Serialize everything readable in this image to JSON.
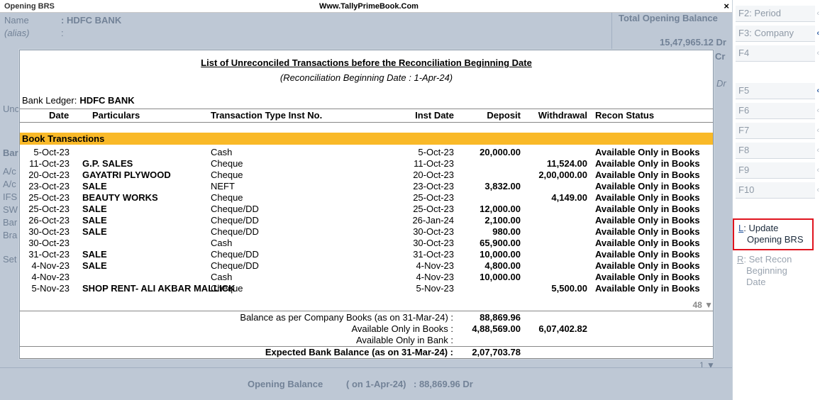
{
  "window": {
    "title": "Opening BRS",
    "site": "Www.TallyPrimeBook.Com",
    "close": "×"
  },
  "background": {
    "name_label": "Name",
    "name_value": ": HDFC BANK",
    "alias_label": "(alias)",
    "alias_colon": ":",
    "total_label": "Total Opening Balance",
    "total_value": "15,47,965.12 Dr",
    "cr_fragment": "Cr",
    "dr_fragment": "Dr",
    "unc_fragment": "Unc",
    "bank_fragment": "Bar",
    "ac1_fragment": "A/c",
    "ac2_fragment": "A/c",
    "ifs_fragment": "IFS",
    "sw_fragment": "SW",
    "ban_fragment": "Bar",
    "bra_fragment": "Bra",
    "set_fragment": "Set",
    "opening_label": "Opening Balance",
    "opening_on": "( on 1-Apr-24)",
    "opening_value": ":  88,869.96 Dr",
    "page_indicator": "1 ▼"
  },
  "modal": {
    "title": "List of Unreconciled Transactions before the Reconciliation Beginning Date",
    "subtitle": "(Reconciliation Beginning Date :  1-Apr-24)",
    "bank_ledger_label": "Bank Ledger:",
    "bank_ledger_value": "HDFC BANK",
    "columns": {
      "date": "Date",
      "particulars": "Particulars",
      "type_inst": "Transaction Type  Inst No.",
      "inst_date": "Inst Date",
      "deposit": "Deposit",
      "withdrawal": "Withdrawal",
      "status": "Recon Status"
    },
    "section": "Book Transactions",
    "rows": [
      {
        "date": "5-Oct-23",
        "particulars": "",
        "type": "Cash",
        "inst_date": "5-Oct-23",
        "deposit": "20,000.00",
        "withdrawal": "",
        "status": "Available Only in Books"
      },
      {
        "date": "11-Oct-23",
        "particulars": "G.P. SALES",
        "type": "Cheque",
        "inst_date": "11-Oct-23",
        "deposit": "",
        "withdrawal": "11,524.00",
        "status": "Available Only in Books"
      },
      {
        "date": "20-Oct-23",
        "particulars": "GAYATRI PLYWOOD",
        "type": "Cheque",
        "inst_date": "20-Oct-23",
        "deposit": "",
        "withdrawal": "2,00,000.00",
        "status": "Available Only in Books"
      },
      {
        "date": "23-Oct-23",
        "particulars": "SALE",
        "type": "NEFT",
        "inst_date": "23-Oct-23",
        "deposit": "3,832.00",
        "withdrawal": "",
        "status": "Available Only in Books"
      },
      {
        "date": "25-Oct-23",
        "particulars": "BEAUTY WORKS",
        "type": "Cheque",
        "inst_date": "25-Oct-23",
        "deposit": "",
        "withdrawal": "4,149.00",
        "status": "Available Only in Books"
      },
      {
        "date": "25-Oct-23",
        "particulars": "SALE",
        "type": "Cheque/DD",
        "inst_date": "25-Oct-23",
        "deposit": "12,000.00",
        "withdrawal": "",
        "status": "Available Only in Books"
      },
      {
        "date": "26-Oct-23",
        "particulars": "SALE",
        "type": "Cheque/DD",
        "inst_date": "26-Jan-24",
        "deposit": "2,100.00",
        "withdrawal": "",
        "status": "Available Only in Books"
      },
      {
        "date": "30-Oct-23",
        "particulars": "SALE",
        "type": "Cheque/DD",
        "inst_date": "30-Oct-23",
        "deposit": "980.00",
        "withdrawal": "",
        "status": "Available Only in Books"
      },
      {
        "date": "30-Oct-23",
        "particulars": "",
        "type": "Cash",
        "inst_date": "30-Oct-23",
        "deposit": "65,900.00",
        "withdrawal": "",
        "status": "Available Only in Books"
      },
      {
        "date": "31-Oct-23",
        "particulars": "SALE",
        "type": "Cheque/DD",
        "inst_date": "31-Oct-23",
        "deposit": "10,000.00",
        "withdrawal": "",
        "status": "Available Only in Books"
      },
      {
        "date": "4-Nov-23",
        "particulars": "SALE",
        "type": "Cheque/DD",
        "inst_date": "4-Nov-23",
        "deposit": "4,800.00",
        "withdrawal": "",
        "status": "Available Only in Books"
      },
      {
        "date": "4-Nov-23",
        "particulars": "",
        "type": "Cash",
        "inst_date": "4-Nov-23",
        "deposit": "10,000.00",
        "withdrawal": "",
        "status": "Available Only in Books"
      },
      {
        "date": "5-Nov-23",
        "particulars": "SHOP RENT- ALI AKBAR MALLICK",
        "type": "Cheque",
        "inst_date": "5-Nov-23",
        "deposit": "",
        "withdrawal": "5,500.00",
        "status": "Available Only in Books"
      }
    ],
    "more_indicator": "48 ▼",
    "summary": {
      "balance_label": "Balance as per Company Books (as on 31-Mar-24) :",
      "balance_value": "88,869.96",
      "books_label": "Available Only in Books :",
      "books_deposit": "4,88,569.00",
      "books_withdrawal": "6,07,402.82",
      "bank_label": "Available Only in Bank :",
      "expected_label": "Expected Bank Balance (as on 31-Mar-24) :",
      "expected_value": "2,07,703.78"
    }
  },
  "panel": {
    "f2": "F2: Period",
    "f3": "F3: Company",
    "f4": "F4",
    "f5": "F5",
    "f6": "F6",
    "f7": "F7",
    "f8": "F8",
    "f9": "F9",
    "f10": "F10",
    "update_key": "L",
    "update_label_1": ": Update",
    "update_label_2": "Opening BRS",
    "recon_key": "R",
    "recon_label_1": ": Set Recon",
    "recon_label_2": "Beginning",
    "recon_label_3": "Date",
    "arrow": "‹"
  },
  "colors": {
    "section_bg": "#f9b928",
    "highlight_border": "#e0141e",
    "accent": "#2c5aa0"
  }
}
